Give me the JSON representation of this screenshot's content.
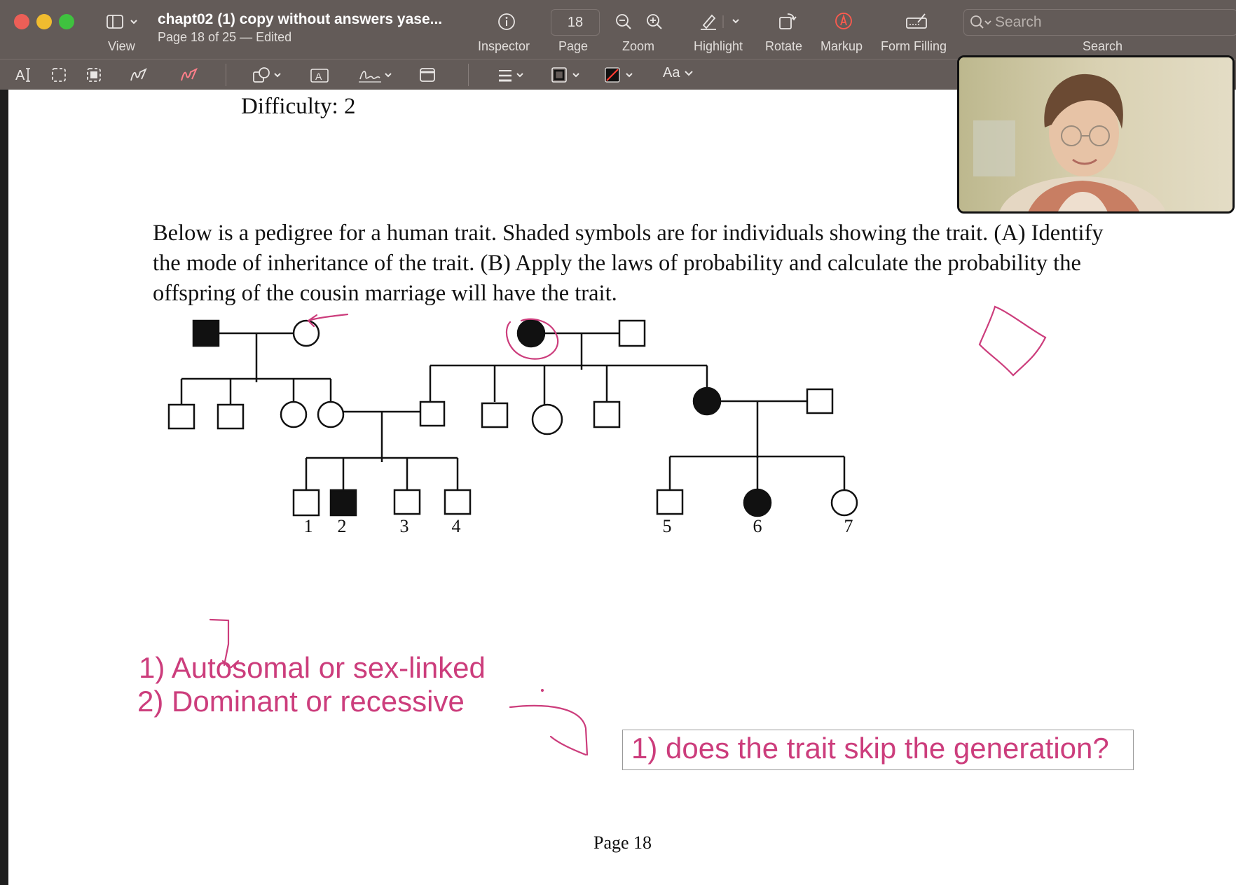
{
  "window": {
    "title": "chapt02 (1) copy without answers yase...",
    "subtitle": "Page 18 of 25 — Edited",
    "view_label": "View"
  },
  "toolbar": {
    "inspector_label": "Inspector",
    "page_value": "18",
    "page_label": "Page",
    "zoom_label": "Zoom",
    "highlight_label": "Highlight",
    "rotate_label": "Rotate",
    "markup_label": "Markup",
    "form_filling_label": "Form Filling",
    "search_label": "Search",
    "search_placeholder": "Search",
    "text_style_label": "Aa"
  },
  "markup_tools": [
    "text-selection-icon",
    "rect-selection-icon",
    "smart-lasso-icon",
    "sketch-icon",
    "draw-icon",
    "shapes-icon",
    "text-box-icon",
    "signature-icon",
    "note-icon",
    "line-style-icon",
    "border-color-icon",
    "fill-color-icon"
  ],
  "colors": {
    "annotation": "#cc3d7c",
    "toolbar": "#635b58",
    "markup_active": "#ff5a4e"
  },
  "document": {
    "difficulty": "Difficulty:  2",
    "question": "Below is a pedigree for a human trait. Shaded symbols are for individuals showing the trait. (A) Identify the mode of inheritance of the trait. (B) Apply the laws of probability and calculate the probability the offspring of the cousin marriage will have the trait.",
    "pedigree_labels": [
      "1",
      "2",
      "3",
      "4",
      "5",
      "6",
      "7"
    ],
    "page_number": "Page 18"
  },
  "annotations": {
    "note1": "1) Autosomal or sex-linked",
    "note2": "2) Dominant or recessive",
    "box_text": "1) does the trait skip the generation?"
  }
}
